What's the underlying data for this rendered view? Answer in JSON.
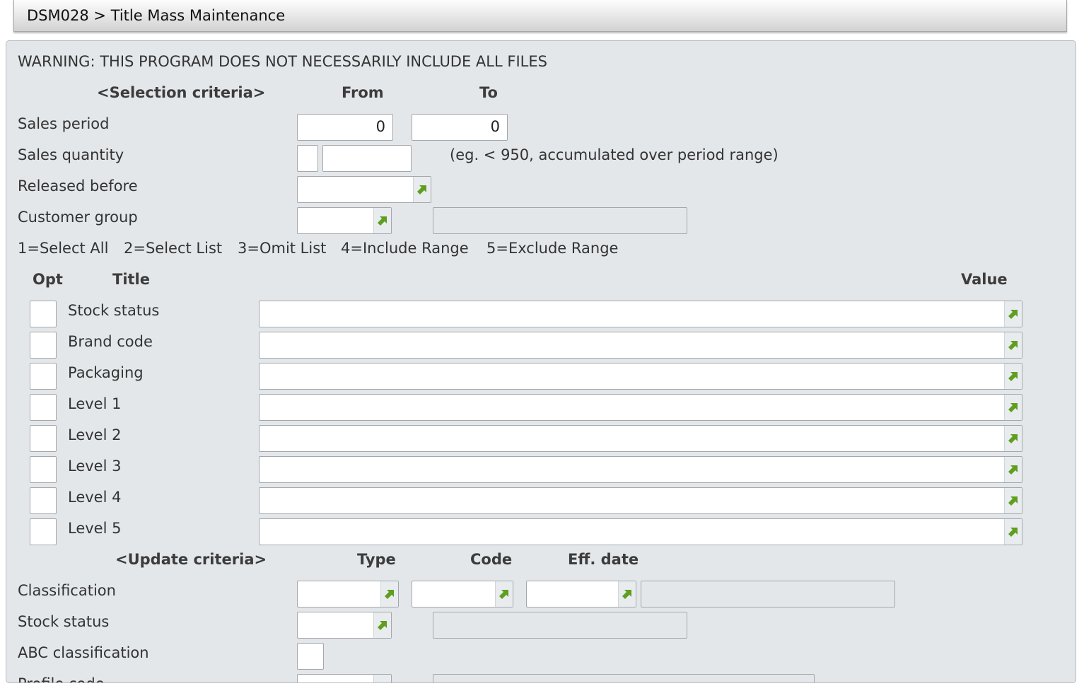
{
  "window": {
    "title": "DSM028 > Title Mass Maintenance"
  },
  "warning": "WARNING: THIS PROGRAM DOES NOT NECESSARILY INCLUDE ALL FILES",
  "selection": {
    "header": "<Selection criteria>",
    "from_label": "From",
    "to_label": "To",
    "sales_period": {
      "label": "Sales period",
      "from": "0",
      "to": "0"
    },
    "sales_quantity": {
      "label": "Sales quantity",
      "operator": "",
      "value": "",
      "hint": "(eg. < 950, accumulated over period range)"
    },
    "released_before": {
      "label": "Released before",
      "value": ""
    },
    "customer_group": {
      "label": "Customer group",
      "value": "",
      "description": ""
    }
  },
  "options_legend": [
    "1=Select All",
    "2=Select List",
    "3=Omit List",
    "4=Include Range",
    "5=Exclude Range"
  ],
  "filter_table": {
    "col_opt": "Opt",
    "col_title": "Title",
    "col_value": "Value",
    "rows": [
      {
        "title": "Stock status",
        "opt": "",
        "value": ""
      },
      {
        "title": "Brand code",
        "opt": "",
        "value": ""
      },
      {
        "title": "Packaging",
        "opt": "",
        "value": ""
      },
      {
        "title": "Level 1",
        "opt": "",
        "value": ""
      },
      {
        "title": "Level 2",
        "opt": "",
        "value": ""
      },
      {
        "title": "Level 3",
        "opt": "",
        "value": ""
      },
      {
        "title": "Level 4",
        "opt": "",
        "value": ""
      },
      {
        "title": "Level 5",
        "opt": "",
        "value": ""
      }
    ]
  },
  "update": {
    "header": "<Update criteria>",
    "type_label": "Type",
    "code_label": "Code",
    "eff_date_label": "Eff. date",
    "classification": {
      "label": "Classification",
      "type": "",
      "code": "",
      "eff_date": "",
      "description": ""
    },
    "stock_status": {
      "label": "Stock status",
      "value": "",
      "description": ""
    },
    "abc_classification": {
      "label": "ABC classification",
      "value": ""
    },
    "profile_code": {
      "label": "Profile code"
    }
  },
  "icons": {
    "prompt": "prompt-arrow-icon"
  },
  "colors": {
    "prompt_icon": "#5f9e1f",
    "panel_bg": "#e4e7ea"
  }
}
